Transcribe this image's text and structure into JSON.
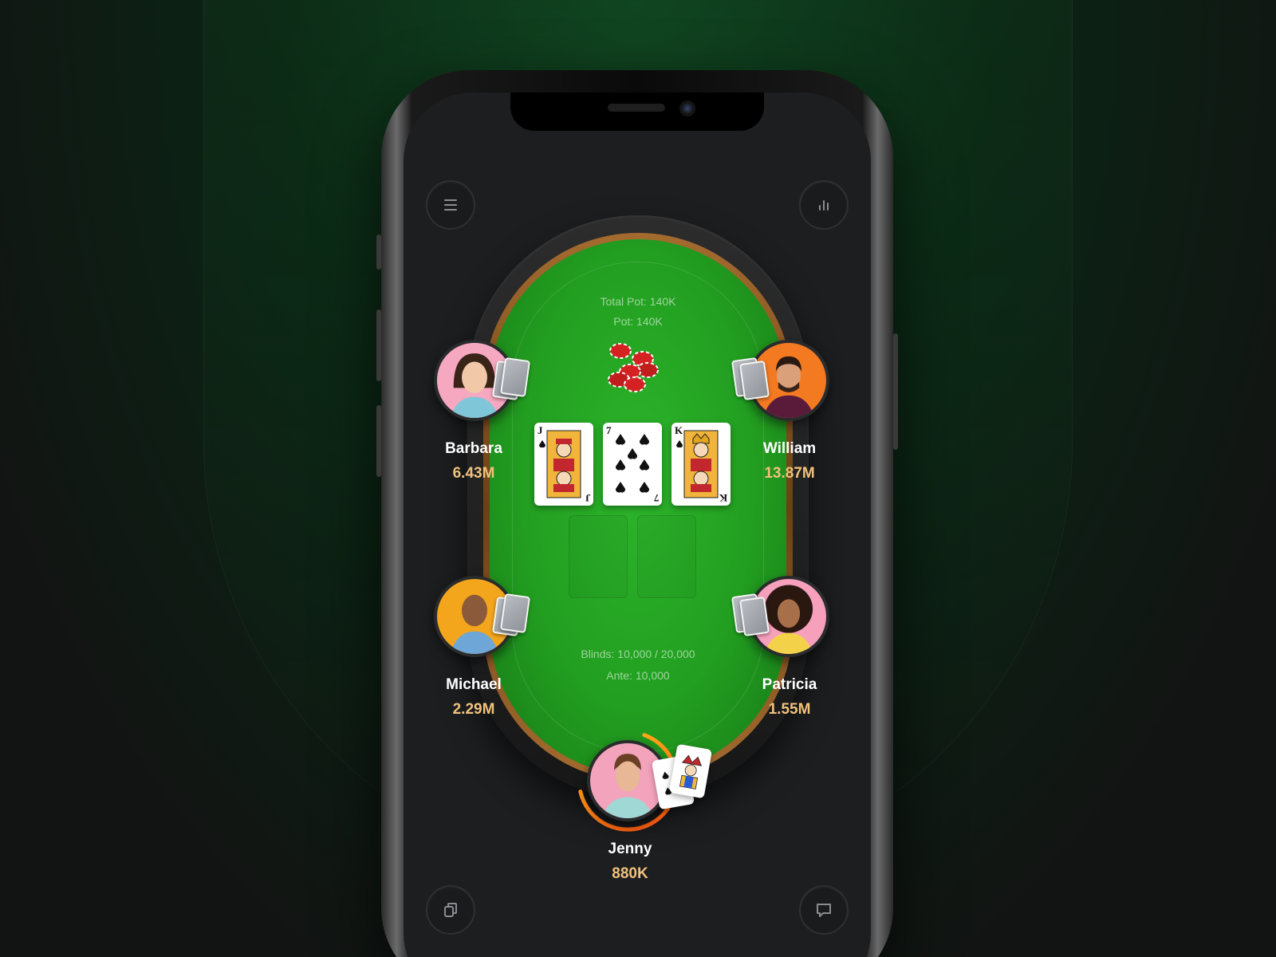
{
  "app": {
    "accent_color": "#f2c17a",
    "felt_color": "#229e20",
    "timer_color": "#ff7a1a"
  },
  "toolbar": {
    "menu_icon": "hamburger-menu-icon",
    "stats_icon": "bar-chart-icon",
    "cards_icon": "copy-cards-icon",
    "chat_icon": "chat-bubble-icon"
  },
  "table": {
    "total_pot": "Total Pot: 140K",
    "pot": "Pot: 140K",
    "blinds": "Blinds: 10,000 / 20,000",
    "ante": "Ante: 10,000",
    "community_cards": [
      {
        "rank": "J",
        "suit": "spades",
        "face": "jack"
      },
      {
        "rank": "7",
        "suit": "spades",
        "face": "pips"
      },
      {
        "rank": "K",
        "suit": "spades",
        "face": "king"
      }
    ]
  },
  "players": {
    "barbara": {
      "name": "Barbara",
      "chips": "6.43M"
    },
    "william": {
      "name": "William",
      "chips": "13.87M"
    },
    "michael": {
      "name": "Michael",
      "chips": "2.29M"
    },
    "patricia": {
      "name": "Patricia",
      "chips": "1.55M"
    },
    "jenny": {
      "name": "Jenny",
      "chips": "880K",
      "hole_cards": [
        "spades",
        "joker"
      ]
    }
  }
}
